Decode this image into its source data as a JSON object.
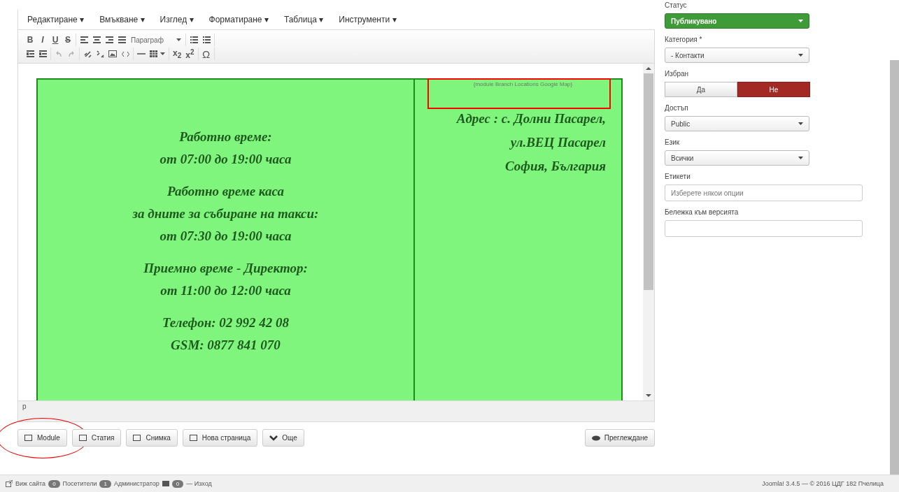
{
  "menu": [
    "Редактиране ▾",
    "Вмъкване ▾",
    "Изглед ▾",
    "Форматиране ▾",
    "Таблица ▾",
    "Инструменти ▾"
  ],
  "toolbar": {
    "format_buttons": [
      "B",
      "I",
      "U",
      "S"
    ],
    "block_format": "Параграф",
    "subscript": "x$_{2}$",
    "superscript": "x$^{2}$",
    "special_char": "Ω"
  },
  "content": {
    "hours_paragraphs": [
      [
        "Работно време:",
        "от 07:00 до 19:00 часа"
      ],
      [
        "Работно време каса",
        "за дните за събиране на такси:",
        "от 07:30 до 19:00 часа"
      ],
      [
        "Приемно време - Директор:",
        "от 11:00 до 12:00 часа"
      ],
      [
        "Телефон: 02 992 42 08",
        "GSM: 0877 841 070"
      ]
    ],
    "module_tag": "{module Branch Locations Google Map}",
    "address_lines": [
      "Адрес :  с. Долни Пасарел,",
      "ул.ВЕЦ Пасарел",
      "София, България"
    ]
  },
  "path": "p",
  "editor_buttons": [
    {
      "label": "Module",
      "highlighted": true
    },
    {
      "label": "Статия",
      "highlighted": false
    },
    {
      "label": "Снимка",
      "highlighted": false
    },
    {
      "label": "Нова страница",
      "highlighted": false
    },
    {
      "label": "Още",
      "highlighted": false
    }
  ],
  "preview_button": "Преглеждане",
  "fields": [
    {
      "kind": "status",
      "label": "Статус",
      "value": "Публикувано"
    },
    {
      "kind": "select",
      "label": "Категория *",
      "value": "- Контакти"
    },
    {
      "kind": "toggle",
      "label": "Избран",
      "options": [
        {
          "label": "Да",
          "selected": false
        },
        {
          "label": "Не",
          "selected": true
        }
      ]
    },
    {
      "kind": "select",
      "label": "Достъп",
      "value": "Public"
    },
    {
      "kind": "select",
      "label": "Език",
      "value": "Всички"
    },
    {
      "kind": "tags",
      "label": "Етикети",
      "placeholder": "Изберете някои опции"
    },
    {
      "kind": "text",
      "label": "Бележка към версията"
    }
  ],
  "status_bar": {
    "view_site": "Виж сайта",
    "visitors_count": "0",
    "visitors": "Посетители",
    "admins_count": "1",
    "admins": "Администратор",
    "messages_count": "0",
    "logout": "— Изход",
    "version": "Joomla! 3.4.5 — © 2016 ЦДГ 182 Пчелица"
  }
}
